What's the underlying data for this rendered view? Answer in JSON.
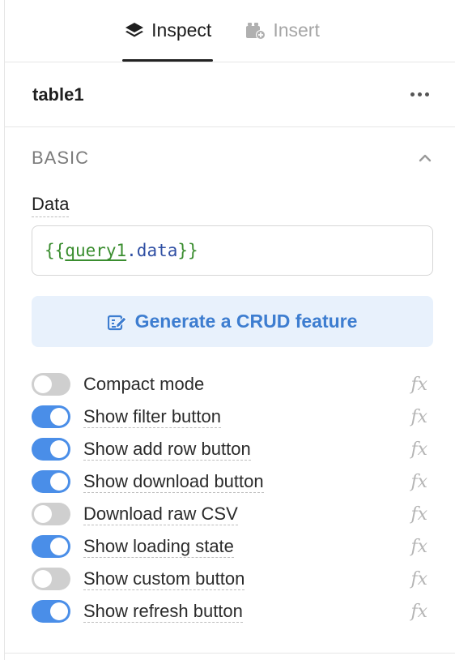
{
  "tabs": [
    {
      "label": "Inspect",
      "icon": "layers-icon",
      "active": true
    },
    {
      "label": "Insert",
      "icon": "add-component-icon",
      "active": false
    }
  ],
  "component": {
    "name": "table1",
    "menu_icon": "more-horizontal-icon"
  },
  "section": {
    "title": "BASIC",
    "data_label": "Data",
    "data_value": {
      "open": "{{",
      "ident": "query1",
      "prop": ".data",
      "close": "}}"
    },
    "crud_button": {
      "label": "Generate a CRUD feature",
      "icon": "edit-table-icon"
    },
    "toggles": [
      {
        "label": "Compact mode",
        "on": false
      },
      {
        "label": "Show filter button",
        "on": true
      },
      {
        "label": "Show add row button",
        "on": true
      },
      {
        "label": "Show download button",
        "on": true
      },
      {
        "label": "Download raw CSV",
        "on": false
      },
      {
        "label": "Show loading state",
        "on": true
      },
      {
        "label": "Show custom button",
        "on": false
      },
      {
        "label": "Show refresh button",
        "on": true
      }
    ],
    "fx_label": "fx"
  },
  "colors": {
    "accent": "#4a8ee8",
    "crud_bg": "#e8f1fc",
    "crud_text": "#3d7dd0"
  }
}
